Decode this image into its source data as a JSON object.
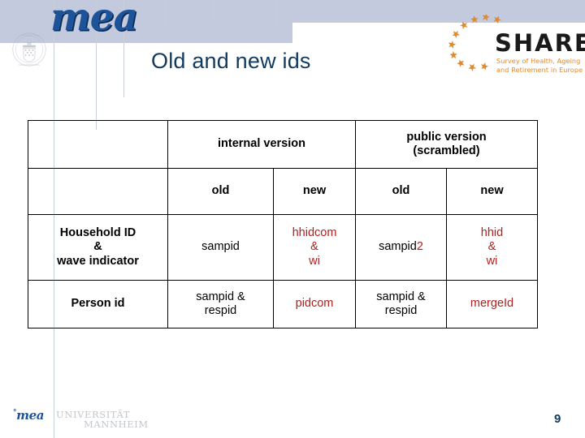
{
  "slide": {
    "title": "Old and new ids",
    "page_number": "9",
    "title_color": "#123a5f",
    "band_color": "#c3cade"
  },
  "branding": {
    "mea_logo_text": "mea",
    "mea_logo_color": "#1d5499",
    "seal_name": "university-seal-icon",
    "share": {
      "wordmark": "SHARE",
      "wordmark_color": "#1a1a1a",
      "tagline_line1": "Survey of Health, Ageing",
      "tagline_line2": "and Retirement in Europe",
      "tagline_color": "#e08a30",
      "star_color": "#e08a30"
    }
  },
  "footer": {
    "mea_mark": "mea",
    "mea_tick": "°",
    "university_line1": "UNIVERSITÄT",
    "university_line2": "MANNHEIM",
    "university_color": "#c2c6cc"
  },
  "table": {
    "colors": {
      "highlight": "#b02020",
      "normal": "#000000",
      "border": "#000000"
    },
    "group_headers": [
      {
        "label": "internal version",
        "span": 2
      },
      {
        "label": "public version\n(scrambled)",
        "line1": "public version",
        "line2": "(scrambled)",
        "span": 2
      }
    ],
    "sub_headers": [
      "old",
      "new",
      "old",
      "new"
    ],
    "rows": [
      {
        "label_lines": [
          "Household ID",
          "&",
          "wave indicator"
        ],
        "cells": [
          {
            "parts": [
              {
                "text": "sampid",
                "color": "normal"
              }
            ]
          },
          {
            "parts": [
              {
                "text": "hhidcom",
                "color": "highlight"
              },
              {
                "text": "&",
                "color": "highlight"
              },
              {
                "text": "wi",
                "color": "highlight"
              }
            ]
          },
          {
            "parts": [
              {
                "text": "sampid",
                "color": "normal",
                "inline": true
              },
              {
                "text": "2",
                "color": "highlight",
                "inline": true
              }
            ]
          },
          {
            "parts": [
              {
                "text": "hhid",
                "color": "highlight"
              },
              {
                "text": "&",
                "color": "highlight"
              },
              {
                "text": "wi",
                "color": "highlight"
              }
            ]
          }
        ]
      },
      {
        "label_lines": [
          "Person id"
        ],
        "cells": [
          {
            "parts": [
              {
                "text": "sampid &",
                "color": "normal"
              },
              {
                "text": "respid",
                "color": "normal"
              }
            ]
          },
          {
            "parts": [
              {
                "text": "pidcom",
                "color": "highlight"
              }
            ]
          },
          {
            "parts": [
              {
                "text": "sampid &",
                "color": "normal"
              },
              {
                "text": "respid",
                "color": "normal"
              }
            ]
          },
          {
            "parts": [
              {
                "text": "mergeId",
                "color": "highlight"
              }
            ]
          }
        ]
      }
    ]
  }
}
